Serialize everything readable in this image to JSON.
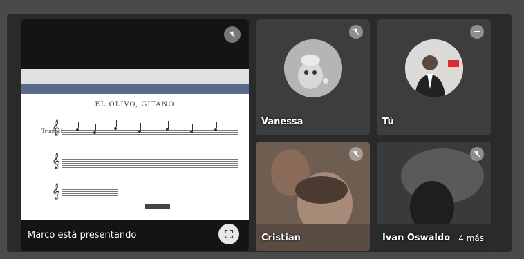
{
  "presenter": {
    "label": "Marco está presentando",
    "document": {
      "title": "EL OLIVO, GITANO",
      "instrument": "Trumpet"
    }
  },
  "participants": [
    {
      "id": "vanessa",
      "name": "Vanessa",
      "muted": true
    },
    {
      "id": "you",
      "name": "Tú",
      "muted": false
    },
    {
      "id": "cristian",
      "name": "Cristian",
      "muted": true
    },
    {
      "id": "ivan",
      "name": "Ivan Oswaldo",
      "muted": true
    }
  ],
  "overflow": {
    "label": "4 más"
  },
  "icons": {
    "mic_off": "mic-off-icon",
    "audio_level": "audio-level-icon",
    "fullscreen": "fullscreen-icon"
  },
  "colors": {
    "background": "#2a2a2a",
    "tile": "#3c3c3c",
    "text": "#ffffff"
  }
}
